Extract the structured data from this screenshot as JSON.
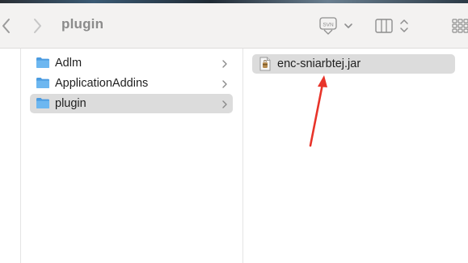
{
  "toolbar": {
    "title": "plugin",
    "back_icon": "chevron-left-icon",
    "forward_icon": "chevron-right-icon",
    "svn_icon": "svn-icon",
    "view_icon": "column-view-icon",
    "grid_icon": "grid-icon"
  },
  "sidebar_column": {
    "items": [
      {
        "label": "Adlm",
        "icon": "folder-icon",
        "selected": false
      },
      {
        "label": "ApplicationAddins",
        "icon": "folder-icon",
        "selected": false
      },
      {
        "label": "plugin",
        "icon": "folder-icon",
        "selected": true
      }
    ]
  },
  "contents_column": {
    "items": [
      {
        "label": "enc-sniarbtej.jar",
        "icon": "jar-file-icon",
        "selected": true
      }
    ]
  },
  "annotation": {
    "arrow_color": "#e8342a"
  },
  "colors": {
    "folder_blue": "#5aa8e6",
    "selection_gray": "#dcdcdc",
    "toolbar_bg": "#f3f2f1"
  }
}
